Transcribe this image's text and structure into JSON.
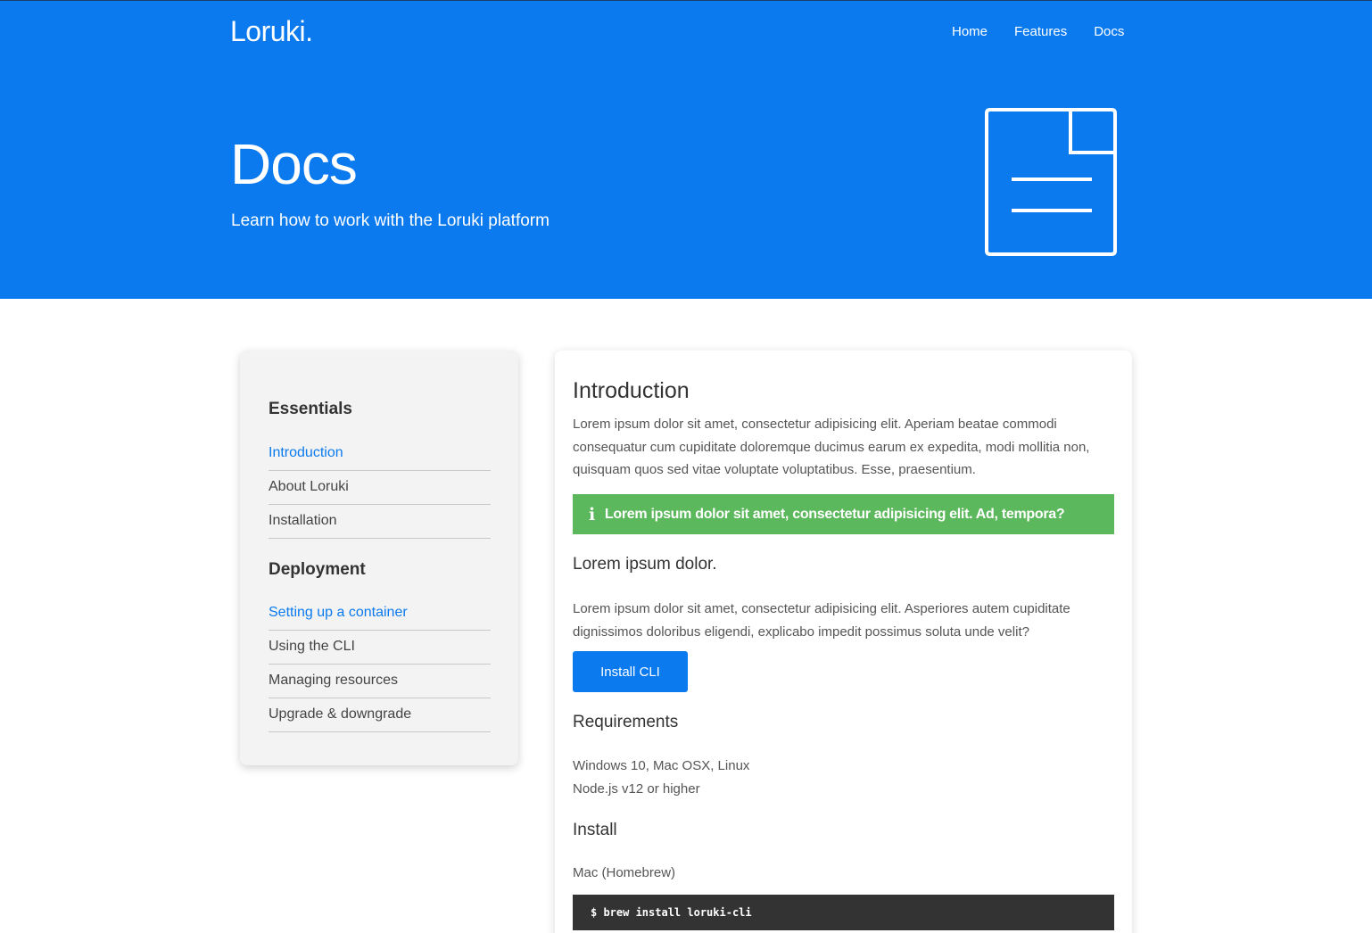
{
  "header": {
    "logo": "Loruki.",
    "nav": [
      "Home",
      "Features",
      "Docs"
    ],
    "title": "Docs",
    "subtitle": "Learn how to work with the Loruki platform",
    "icon": "document-icon"
  },
  "sidebar": {
    "sections": [
      {
        "heading": "Essentials",
        "items": [
          {
            "label": "Introduction",
            "active": true
          },
          {
            "label": "About Loruki",
            "active": false
          },
          {
            "label": "Installation",
            "active": false
          }
        ]
      },
      {
        "heading": "Deployment",
        "items": [
          {
            "label": "Setting up a container",
            "active": true
          },
          {
            "label": "Using the CLI",
            "active": false
          },
          {
            "label": "Managing resources",
            "active": false
          },
          {
            "label": "Upgrade & downgrade",
            "active": false
          }
        ]
      }
    ]
  },
  "main": {
    "intro_heading": "Introduction",
    "intro_text": "Lorem ipsum dolor sit amet, consectetur adipisicing elit. Aperiam beatae commodi consequatur cum cupiditate doloremque ducimus earum ex expedita, modi mollitia non, quisquam quos sed vitae voluptate voluptatibus. Esse, praesentium.",
    "notice_icon": "i",
    "notice_text": "Lorem ipsum dolor sit amet, consectetur adipisicing elit. Ad, tempora?",
    "sub_heading": "Lorem ipsum dolor.",
    "sub_text": "Lorem ipsum dolor sit amet, consectetur adipisicing elit. Asperiores autem cupiditate dignissimos doloribus eligendi, explicabo impedit possimus soluta unde velit?",
    "button_label": "Install CLI",
    "requirements_heading": "Requirements",
    "requirements": [
      "Windows 10, Mac OSX, Linux",
      "Node.js v12 or higher"
    ],
    "install_heading": "Install",
    "mac_label": "Mac (Homebrew)",
    "code": "$ brew install loruki-cli"
  },
  "colors": {
    "primary": "#0a7aee",
    "success": "#5cb85c",
    "code_bg": "#333333",
    "sidebar_bg": "#f3f3f3"
  }
}
